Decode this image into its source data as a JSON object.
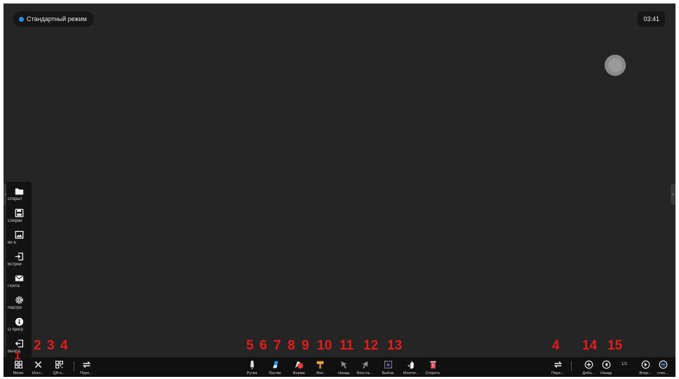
{
  "header": {
    "mode_label": "Стандартный режим",
    "time": "03:41"
  },
  "edge_tabs": {
    "left": "‹",
    "right": "›"
  },
  "side_menu": [
    {
      "label": "Открыт",
      "icon": "folder-icon"
    },
    {
      "label": "Сохран",
      "icon": "save-icon"
    },
    {
      "label": "ие   Б",
      "icon": "image-icon"
    },
    {
      "label": "Встрои",
      "icon": "import-icon"
    },
    {
      "label": "Почта",
      "icon": "mail-icon"
    },
    {
      "label": "Настро",
      "icon": "gear-icon"
    },
    {
      "label": "О прогр",
      "icon": "info-icon"
    },
    {
      "label": "Выход",
      "icon": "exit-icon"
    }
  ],
  "toolbar_left": [
    {
      "label": "Меню",
      "icon": "grid-icon"
    },
    {
      "label": "Инст...",
      "icon": "tools-icon"
    },
    {
      "label": "QR-к...",
      "icon": "qr-icon"
    },
    {
      "label": "Пере...",
      "icon": "switch-icon"
    }
  ],
  "toolbar_center": [
    {
      "label": "Ручка",
      "icon": "pen-icon"
    },
    {
      "label": "Ластик",
      "icon": "eraser-icon"
    },
    {
      "label": "Форма",
      "icon": "shape-icon"
    },
    {
      "label": "Фон",
      "icon": "background-icon"
    },
    {
      "label": "Назад",
      "icon": "undo-icon"
    },
    {
      "label": "Восста...",
      "icon": "redo-icon"
    },
    {
      "label": "Выбор",
      "icon": "select-icon"
    },
    {
      "label": "Многот...",
      "icon": "multitouch-icon"
    },
    {
      "label": "Стереть",
      "icon": "clear-icon"
    }
  ],
  "toolbar_right": [
    {
      "label": "Пере...",
      "icon": "switch-icon"
    },
    {
      "label": "Доба...",
      "icon": "add-page-icon"
    },
    {
      "label": "Назад",
      "icon": "prev-page-icon"
    },
    {
      "label": "Впер...",
      "icon": "next-page-icon"
    },
    {
      "label": "спис...",
      "icon": "page-list-icon"
    }
  ],
  "page_counter": "1/1",
  "annotations": [
    "1",
    "2",
    "3",
    "4",
    "5",
    "6",
    "7",
    "8",
    "9",
    "10",
    "11",
    "12",
    "13",
    "4",
    "14",
    "15"
  ],
  "colors": {
    "board": "#252525",
    "toolbar": "#101010",
    "annotation": "#e41c1c",
    "accent": "#2a8cf0"
  }
}
